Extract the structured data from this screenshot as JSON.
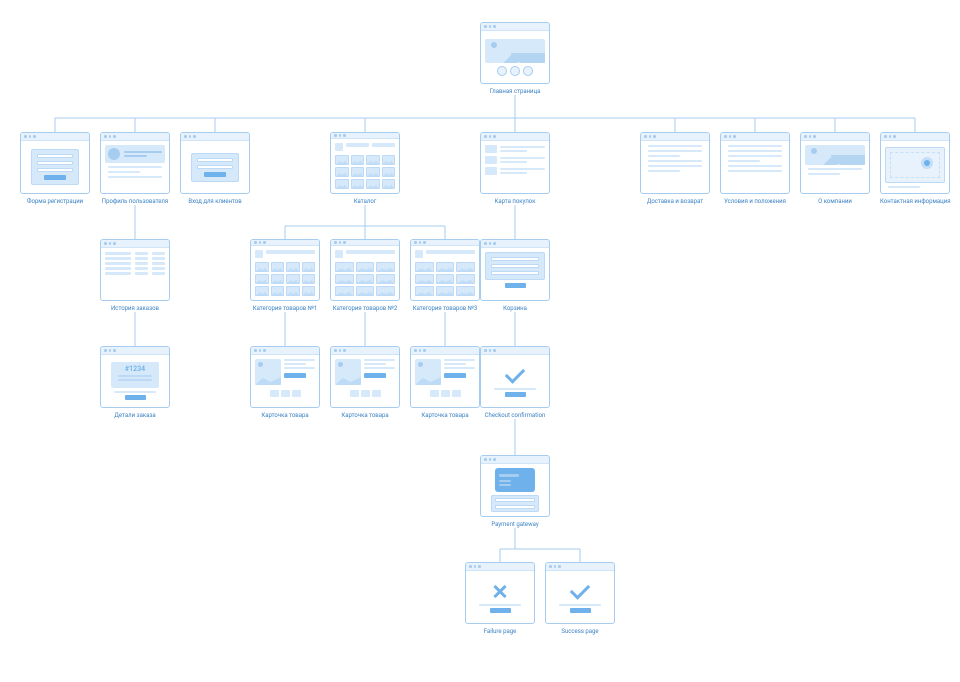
{
  "nodes": {
    "home": {
      "label": "Главная страница"
    },
    "register": {
      "label": "Форма регистрации"
    },
    "profile": {
      "label": "Профиль пользователя"
    },
    "login": {
      "label": "Вход для клиентов"
    },
    "catalog": {
      "label": "Каталог"
    },
    "cart": {
      "label": "Карта покупок"
    },
    "delivery": {
      "label": "Доставка и возврат"
    },
    "terms": {
      "label": "Условия и положения"
    },
    "about": {
      "label": "О компании"
    },
    "contact": {
      "label": "Контактная информация"
    },
    "orders": {
      "label": "История заказов"
    },
    "orderDetail": {
      "label": "Детали заказа",
      "orderNumber": "#1234"
    },
    "cat1": {
      "label": "Категория товаров №1"
    },
    "cat2": {
      "label": "Категория товаров №2"
    },
    "cat3": {
      "label": "Категория товаров №3"
    },
    "basket": {
      "label": "Корзина"
    },
    "prod1": {
      "label": "Карточка товара"
    },
    "prod2": {
      "label": "Карточка товара"
    },
    "prod3": {
      "label": "Карточка товара"
    },
    "checkout": {
      "label": "Checkout confirmation"
    },
    "payment": {
      "label": "Payment gateway"
    },
    "failure": {
      "label": "Failure page"
    },
    "success": {
      "label": "Success page"
    }
  },
  "colors": {
    "line": "#a6cdf0",
    "fillLight": "#e8f2fc",
    "fillMid": "#d6e9fa",
    "accent": "#6fb1ea"
  }
}
